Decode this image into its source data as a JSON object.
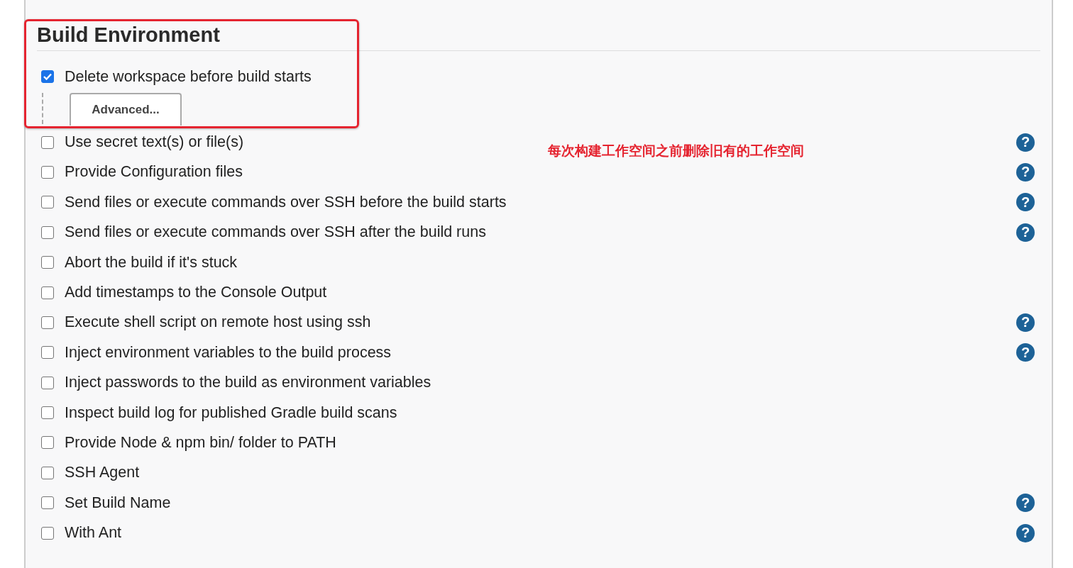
{
  "section": {
    "title": "Build Environment"
  },
  "options": [
    {
      "label": "Delete workspace before build starts",
      "checked": true,
      "advanced_button": "Advanced..."
    },
    {
      "label": "Use secret text(s) or file(s)",
      "checked": false,
      "help": "?"
    },
    {
      "label": "Provide Configuration files",
      "checked": false,
      "help": "?"
    },
    {
      "label": "Send files or execute commands over SSH before the build starts",
      "checked": false,
      "help": "?"
    },
    {
      "label": "Send files or execute commands over SSH after the build runs",
      "checked": false,
      "help": "?"
    },
    {
      "label": "Abort the build if it's stuck",
      "checked": false
    },
    {
      "label": "Add timestamps to the Console Output",
      "checked": false
    },
    {
      "label": "Execute shell script on remote host using ssh",
      "checked": false,
      "help": "?"
    },
    {
      "label": "Inject environment variables to the build process",
      "checked": false,
      "help": "?"
    },
    {
      "label": "Inject passwords to the build as environment variables",
      "checked": false
    },
    {
      "label": "Inspect build log for published Gradle build scans",
      "checked": false
    },
    {
      "label": "Provide Node & npm bin/ folder to PATH",
      "checked": false
    },
    {
      "label": "SSH Agent",
      "checked": false
    },
    {
      "label": "Set Build Name",
      "checked": false,
      "help": "?"
    },
    {
      "label": "With Ant",
      "checked": false,
      "help": "?"
    }
  ],
  "annotation": {
    "note": "每次构建工作空间之前删除旧有的工作空间"
  }
}
